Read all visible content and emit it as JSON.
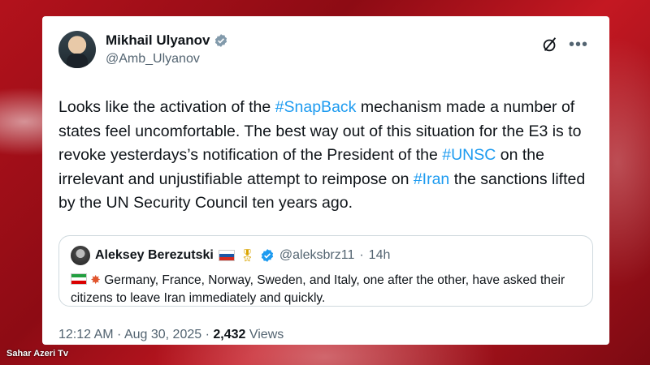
{
  "author": {
    "name": "Mikhail Ulyanov",
    "handle": "@Amb_Ulyanov"
  },
  "tweet": {
    "parts": [
      {
        "text": "Looks like the activation of the ",
        "hashtag": false
      },
      {
        "text": "#SnapBack",
        "hashtag": true
      },
      {
        "text": " mechanism made a number of states feel uncomfortable. The best way out of this situation for the E3 is to revoke yesterdays’s notification of the President of the ",
        "hashtag": false
      },
      {
        "text": "#UNSC",
        "hashtag": true
      },
      {
        "text": " on the irrelevant and unjustifiable  attempt to reimpose on ",
        "hashtag": false
      },
      {
        "text": "#Iran",
        "hashtag": true
      },
      {
        "text": " the sanctions lifted by the UN Security Council ten years ago.",
        "hashtag": false
      }
    ]
  },
  "quote": {
    "name": "Aleksey Berezutski",
    "handle": "@aleksbrz11",
    "separator": "·",
    "time": "14h",
    "text": "Germany, France, Norway, Sweden, and Italy, one after the other, have asked their citizens to leave Iran immediately and quickly."
  },
  "meta": {
    "timestamp": "12:12 AM · Aug 30, 2025 · ",
    "views_count": "2,432",
    "views_label": " Views"
  },
  "watermark": "Sahar Azeri Tv",
  "colors": {
    "link": "#1d9bf0",
    "verified": "#1d9bf0",
    "background": "#b3121c"
  }
}
